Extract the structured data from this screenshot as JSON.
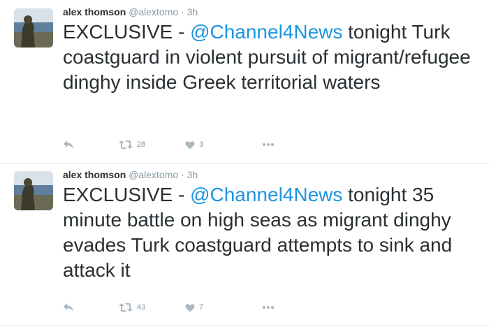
{
  "tweets": [
    {
      "name": "alex thomson",
      "handle": "@alextomo",
      "separator": "·",
      "time": "3h",
      "text_before": "EXCLUSIVE - ",
      "mention": "@Channel4News",
      "text_after": "  tonight Turk coastguard in violent pursuit of migrant/refugee dinghy inside Greek territorial waters",
      "retweets": "28",
      "likes": "3"
    },
    {
      "name": "alex thomson",
      "handle": "@alextomo",
      "separator": "·",
      "time": "3h",
      "text_before": "EXCLUSIVE - ",
      "mention": "@Channel4News",
      "text_after": "  tonight 35 minute battle on high seas as migrant dinghy evades Turk coastguard attempts to sink and attack it",
      "retweets": "43",
      "likes": "7"
    }
  ],
  "icons": {
    "reply": "reply-icon",
    "retweet": "retweet-icon",
    "like": "heart-icon",
    "more": "more-icon"
  },
  "colors": {
    "mention": "#1b95e0",
    "text": "#292f33",
    "meta": "#8899a6",
    "icon": "#aab8c2"
  }
}
